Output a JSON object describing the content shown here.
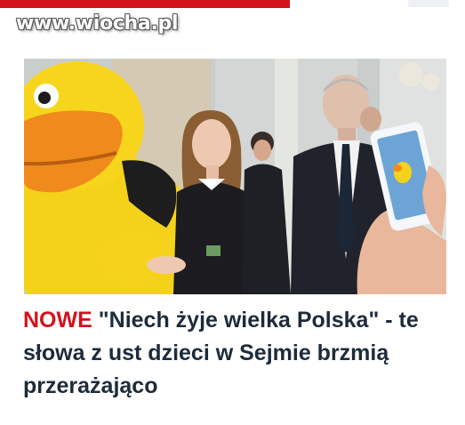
{
  "site": {
    "watermark": "www.wiocha.pl",
    "brand_color": "#d3121c"
  },
  "article": {
    "badge": "NOWE",
    "title": "\"Niech żyje wielka Polska\" - te słowa z ust dzieci w Sejmie brzmią przerażająco",
    "title_color": "#1d2b3a"
  },
  "photo": {
    "subjects": [
      "yellow-duck-mascot",
      "young-girl",
      "woman-in-background",
      "elderly-man-in-suit",
      "hand-holding-phone"
    ]
  }
}
